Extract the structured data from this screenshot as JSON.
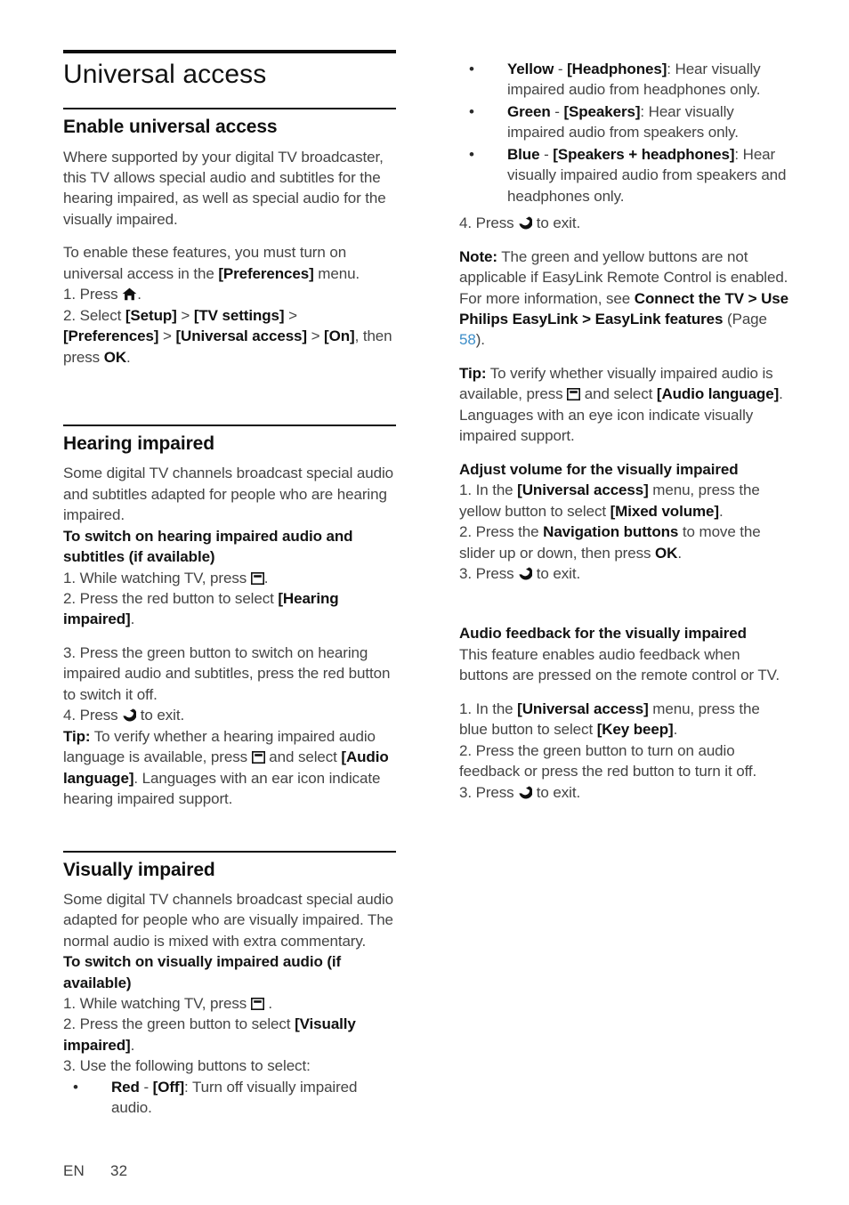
{
  "document": {
    "title": "Universal access",
    "footer": {
      "lang": "EN",
      "page": "32"
    },
    "link_color": "#3d8ec9"
  },
  "icons": {
    "home": "home-icon",
    "options": "options-icon",
    "back": "back-icon"
  },
  "left": {
    "sections": [
      {
        "heading": "Enable universal access",
        "p1": "Where supported by your digital TV broadcaster, this TV allows special audio and subtitles for the hearing impaired, as well as special audio for the visually impaired.",
        "p2_a": "To enable these features, you must turn on universal access in the ",
        "p2_b": "[Preferences]",
        "p2_c": " menu.",
        "step1_a": "1. Press ",
        "step1_b": ".",
        "step2_a": "2. Select ",
        "step2_b": "[Setup]",
        "step2_c": " > ",
        "step2_d": "[TV settings]",
        "step2_e": " > ",
        "step2_f": "[Preferences]",
        "step2_g": " > ",
        "step2_h": "[Universal access]",
        "step2_i": " > ",
        "step2_j": "[On]",
        "step2_k": ", then press ",
        "step2_l": "OK",
        "step2_m": "."
      },
      {
        "heading": "Hearing impaired",
        "p1": "Some digital TV channels broadcast special audio and subtitles adapted for people who are hearing impaired.",
        "sub1": "To switch on hearing impaired audio and subtitles (if available)",
        "step1_a": "1. While watching TV, press ",
        "step1_b": ".",
        "step2_a": "2. Press the red button to select ",
        "step2_b": "[Hearing impaired]",
        "step2_c": ".",
        "step3": "3. Press the green button to switch on hearing impaired audio and subtitles, press the red button to switch it off.",
        "step4_a": "4. Press ",
        "step4_b": " to exit.",
        "tip_label": "Tip:",
        "tip_a": " To verify whether a hearing impaired audio language is available, press ",
        "tip_b": " and select ",
        "tip_c": "[Audio language]",
        "tip_d": ". Languages with an ear icon indicate hearing impaired support."
      },
      {
        "heading": "Visually impaired",
        "p1": "Some digital TV channels broadcast special audio adapted for people who are visually impaired. The normal audio is mixed with extra commentary.",
        "sub1": "To switch on visually impaired audio (if available)",
        "step1_a": "1. While watching TV, press ",
        "step1_b": " .",
        "step2_a": "2. Press the green button to select ",
        "step2_b": "[Visually impaired]",
        "step2_c": ".",
        "step3": "3. Use the following buttons to select:",
        "bullets": [
          {
            "key": "Red",
            "dash": " - ",
            "value": "[Off]",
            "desc": ": Turn off visually impaired audio."
          }
        ]
      }
    ]
  },
  "right": {
    "bullets": [
      {
        "key": "Yellow",
        "dash": " - ",
        "value": "[Headphones]",
        "desc": ": Hear visually impaired audio from headphones only."
      },
      {
        "key": "Green",
        "dash": " - ",
        "value": "[Speakers]",
        "desc": ": Hear visually impaired audio from speakers only."
      },
      {
        "key": "Blue",
        "dash": " - ",
        "value": "[Speakers + headphones]",
        "desc": ": Hear visually impaired audio from speakers and headphones only."
      }
    ],
    "step4_a": "4. Press ",
    "step4_b": " to exit.",
    "note_label": "Note:",
    "note_a": " The green and yellow buttons are not applicable if EasyLink Remote Control is enabled. For more information, see ",
    "note_b": "Connect the TV > Use Philips EasyLink > EasyLink features",
    "note_c": " (Page ",
    "note_page": "58",
    "note_d": ").",
    "tip_label": "Tip:",
    "tip_a": " To verify whether visually impaired audio is available, press ",
    "tip_b": " and select ",
    "tip_c": "[Audio language]",
    "tip_d": ". Languages with an eye icon indicate visually impaired support.",
    "adjust": {
      "heading": "Adjust volume for the visually impaired",
      "step1_a": "1. In the ",
      "step1_b": "[Universal access]",
      "step1_c": " menu, press the yellow button to select ",
      "step1_d": "[Mixed volume]",
      "step1_e": ".",
      "step2_a": "2. Press the ",
      "step2_b": "Navigation buttons",
      "step2_c": " to move the slider up or down, then press ",
      "step2_d": "OK",
      "step2_e": ".",
      "step3_a": "3. Press ",
      "step3_b": " to exit."
    },
    "feedback": {
      "heading": "Audio feedback for the visually impaired",
      "p1": "This feature enables audio feedback when buttons are pressed on the remote control or TV.",
      "step1_a": "1. In the ",
      "step1_b": "[Universal access]",
      "step1_c": " menu, press the blue button to select ",
      "step1_d": "[Key beep]",
      "step1_e": ".",
      "step2": "2. Press the green button to turn on audio feedback or press the red button to turn it off.",
      "step3_a": "3. Press ",
      "step3_b": " to exit."
    }
  }
}
